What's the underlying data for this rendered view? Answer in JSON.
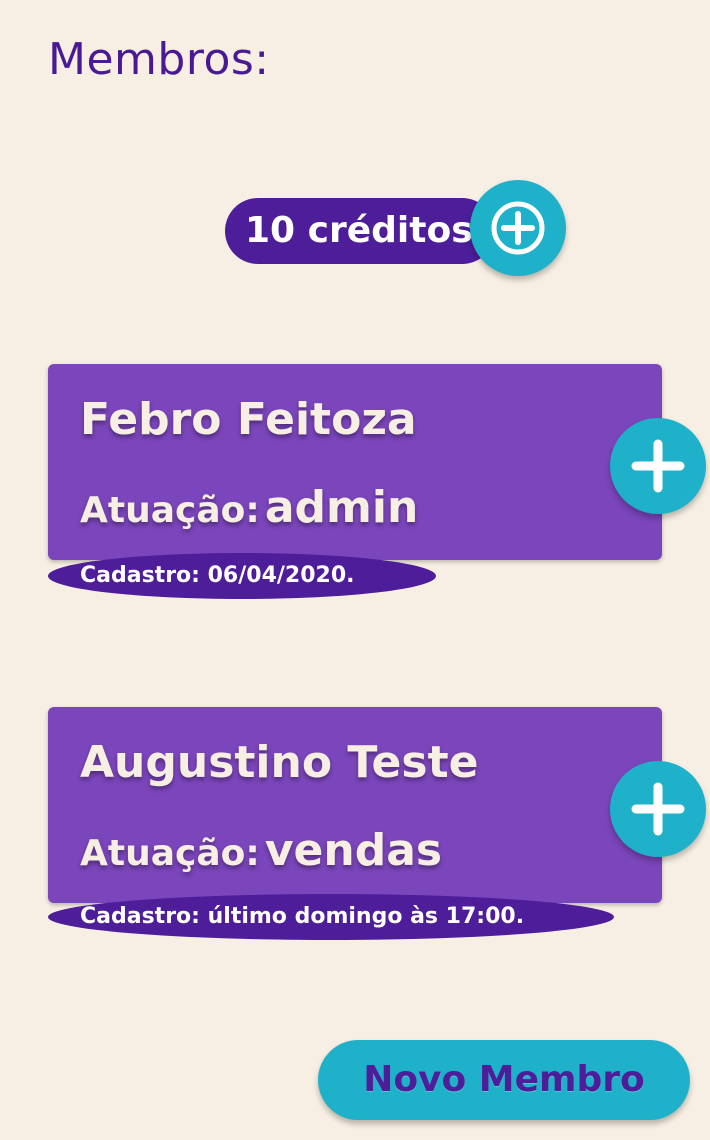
{
  "page": {
    "title": "Membros:"
  },
  "credits": {
    "label": "10 créditos",
    "add_icon": "plus-circle-icon"
  },
  "members": [
    {
      "name": "Febro Feitoza",
      "role_prefix": "Atuação:",
      "role": "admin",
      "cadastro": "Cadastro: 06/04/2020.",
      "add_icon": "plus-icon"
    },
    {
      "name": "Augustino Teste",
      "role_prefix": "Atuação:",
      "role": "vendas",
      "cadastro": "Cadastro: último domingo às 17:00.",
      "add_icon": "plus-icon"
    }
  ],
  "actions": {
    "new_member_label": "Novo Membro"
  },
  "colors": {
    "background": "#f7efe3",
    "primary_purple": "#4e1d9a",
    "card_purple": "#7b45bb",
    "accent_teal": "#1fb1c9",
    "title_purple": "#4a1a94"
  }
}
